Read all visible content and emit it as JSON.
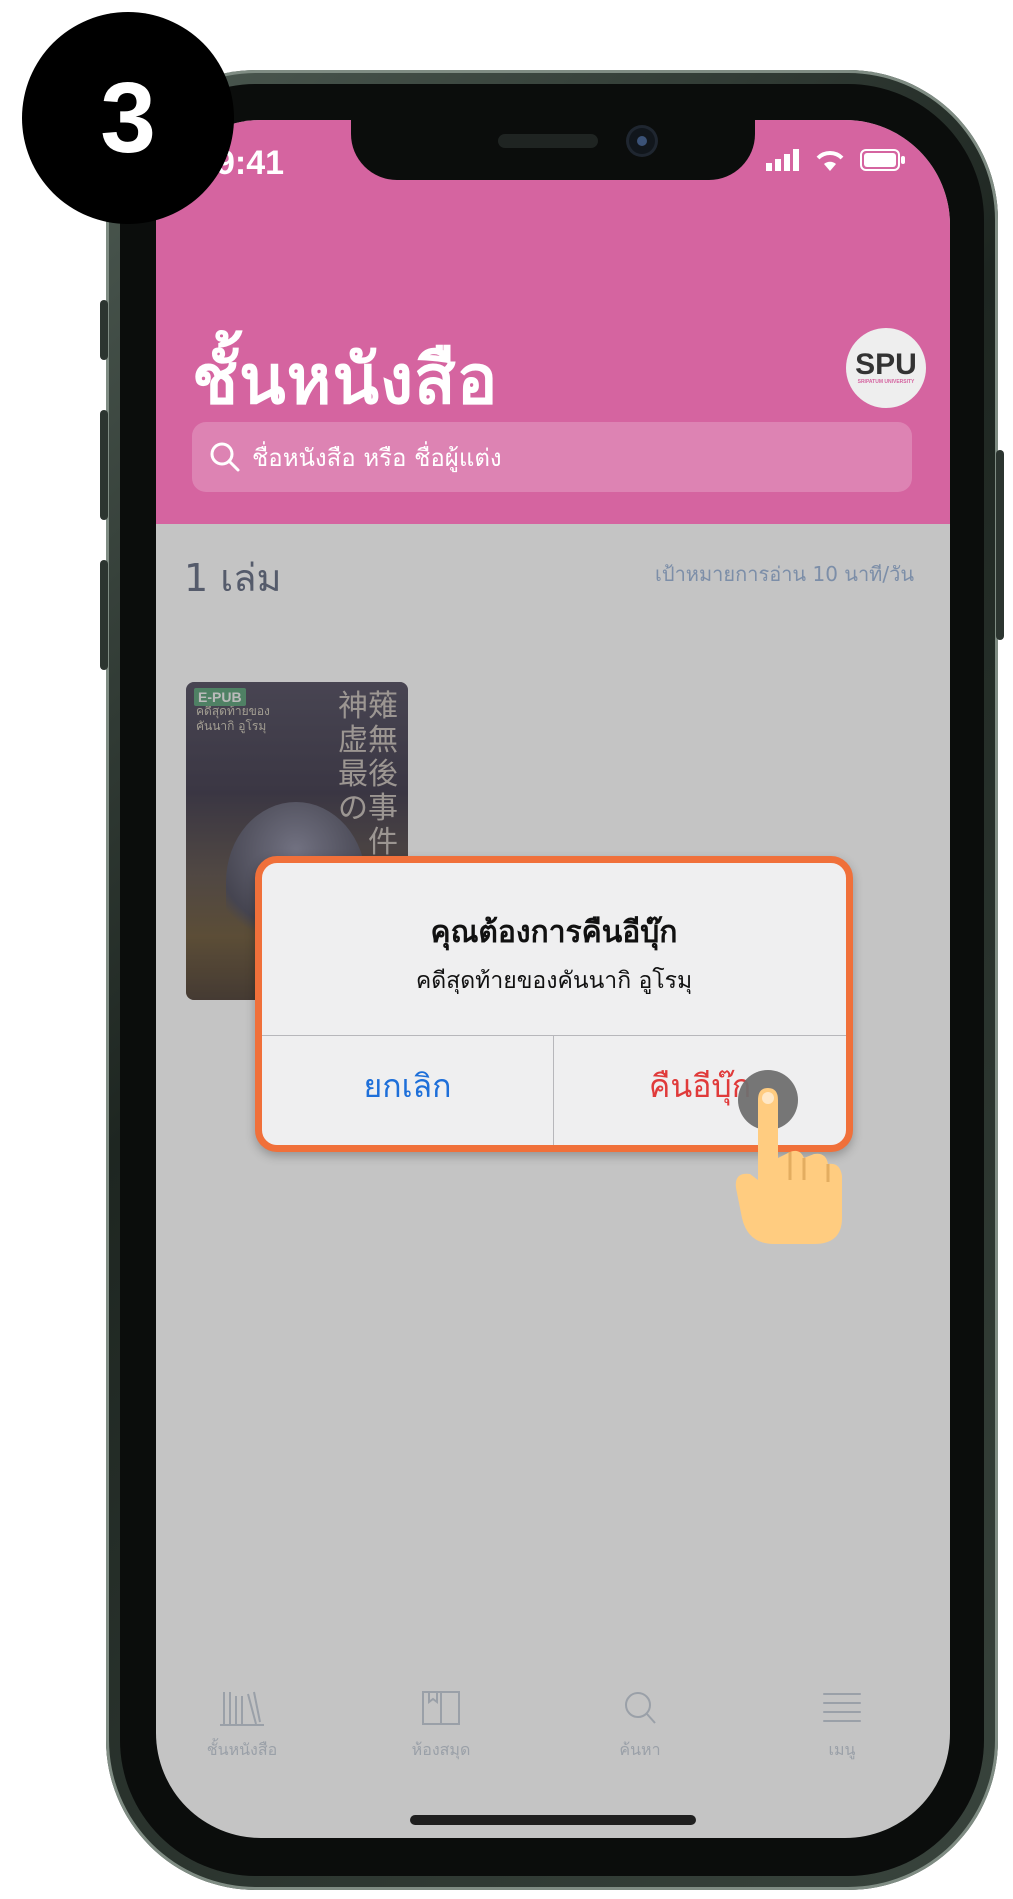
{
  "step_badge": "3",
  "status_bar": {
    "time": "9:41"
  },
  "header": {
    "title": "ชั้นหนังสือ",
    "logo_text": "SPU",
    "logo_subtext": "SRIPATUM UNIVERSITY",
    "search_placeholder": "ชื่อหนังสือ หรือ ชื่อผู้แต่ง"
  },
  "shelf": {
    "count_label": "1 เล่ม",
    "reading_goal": "เป้าหมายการอ่าน 10 นาที/วัน",
    "book": {
      "format_badge": "E-PUB",
      "cover_title": "คดีสุดท้ายของคันนากิ อูโรมุ",
      "cover_kanji": "神薙虚無最後の事件"
    }
  },
  "dialog": {
    "title": "คุณต้องการคืนอีบุ๊ก",
    "message": "คดีสุดท้ายของคันนากิ อูโรมุ",
    "cancel_label": "ยกเลิก",
    "confirm_label": "คืนอีบุ๊ก"
  },
  "tabbar": {
    "items": [
      {
        "label": "ชั้นหนังสือ",
        "icon": "bookshelf-icon"
      },
      {
        "label": "ห้องสมุด",
        "icon": "library-icon"
      },
      {
        "label": "ค้นหา",
        "icon": "search-icon"
      },
      {
        "label": "เมนู",
        "icon": "menu-icon"
      }
    ]
  },
  "colors": {
    "header": "#d564a0",
    "overlay_background": "#c4c4c4",
    "dialog_highlight": "#f0703a",
    "cancel_text": "#1e6fd9",
    "confirm_text": "#e03a3a"
  }
}
